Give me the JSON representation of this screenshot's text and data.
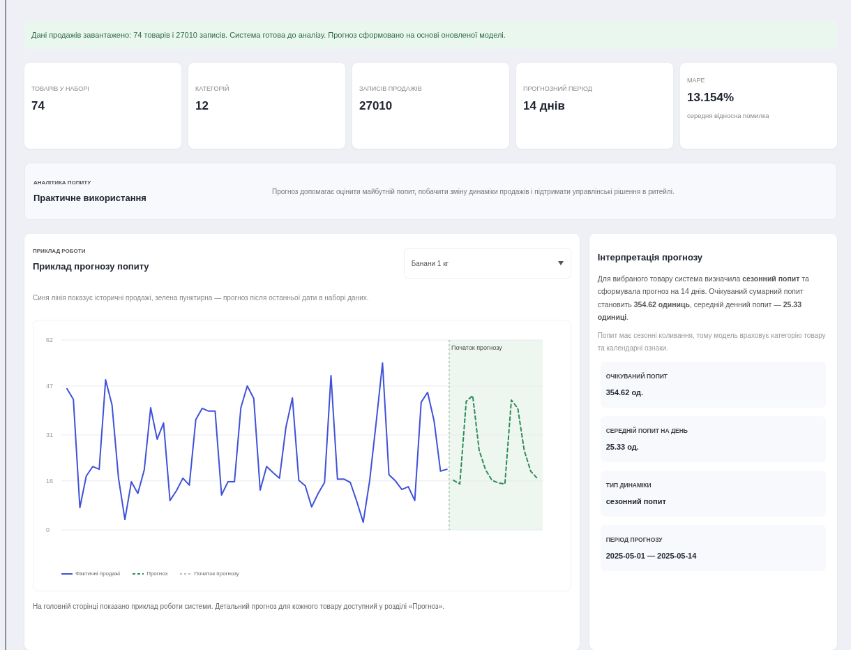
{
  "banner": "Дані продажів завантажено: 74 товарів і 27010 записів. Система готова до аналізу. Прогноз сформовано на основі оновленої моделі.",
  "stats": [
    {
      "label": "ТОВАРІВ У НАБОРІ",
      "value": "74"
    },
    {
      "label": "КАТЕГОРІЙ",
      "value": "12"
    },
    {
      "label": "ЗАПИСІВ ПРОДАЖІВ",
      "value": "27010"
    },
    {
      "label": "ПРОГНОЗНИЙ ПЕРІОД",
      "value": "14 днів"
    },
    {
      "label": "MAPE",
      "value": "13.154%",
      "note": "середня відносна помилка"
    }
  ],
  "usage": {
    "eyebrow": "АНАЛІТИКА ПОПИТУ",
    "title": "Практичне використання",
    "text": "Прогноз допомагає оцінити майбутній попит, побачити зміну динаміки продажів і підтримати управлінські рішення в ритейлі."
  },
  "example": {
    "eyebrow": "ПРИКЛАД РОБОТИ",
    "title": "Приклад прогнозу попиту",
    "product_select": "Банани 1 кг",
    "description": "Синя лінія показує історичні продажі, зелена пунктирна — прогноз після останньої дати в наборі даних.",
    "chart_data": {
      "type": "line",
      "grid": true,
      "ylim": [
        0,
        62
      ],
      "yticks": [
        0,
        16,
        31,
        47,
        62
      ],
      "annotations": [
        {
          "text": "Початок прогнозу"
        }
      ],
      "series": [
        {
          "name": "Фактичні продажі",
          "color": "#3f51d8",
          "line_style": "solid",
          "values": [
            46.1,
            42.6,
            7.3,
            17.6,
            20.7,
            19.8,
            49.0,
            40.8,
            16.9,
            3.4,
            15.7,
            11.9,
            19.6,
            39.9,
            29.6,
            34.9,
            9.6,
            12.8,
            16.9,
            14.6,
            36.0,
            39.7,
            38.8,
            38.8,
            11.4,
            15.7,
            15.7,
            39.9,
            47.0,
            42.9,
            13.0,
            20.7,
            18.7,
            16.9,
            33.5,
            43.1,
            16.2,
            14.4,
            7.5,
            11.9,
            15.5,
            50.4,
            16.6,
            16.6,
            15.5,
            9.3,
            2.5,
            16.0,
            34.9,
            54.5,
            18.0,
            16.0,
            13.2,
            14.1,
            9.6,
            41.7,
            44.9,
            35.6,
            19.2,
            19.8,
            null,
            null,
            null,
            null,
            null,
            null,
            null,
            null,
            null,
            null,
            null,
            null,
            null,
            null
          ]
        },
        {
          "name": "Прогноз",
          "color": "#2e8b57",
          "line_style": "dashed",
          "values": [
            null,
            null,
            null,
            null,
            null,
            null,
            null,
            null,
            null,
            null,
            null,
            null,
            null,
            null,
            null,
            null,
            null,
            null,
            null,
            null,
            null,
            null,
            null,
            null,
            null,
            null,
            null,
            null,
            null,
            null,
            null,
            null,
            null,
            null,
            null,
            null,
            null,
            null,
            null,
            null,
            null,
            null,
            null,
            null,
            null,
            null,
            null,
            null,
            null,
            null,
            null,
            null,
            null,
            null,
            null,
            null,
            null,
            null,
            null,
            null,
            16.2,
            15.0,
            42.0,
            43.8,
            26.0,
            19.6,
            16.2,
            15.3,
            15.0,
            42.4,
            39.7,
            26.0,
            19.2,
            16.9
          ]
        }
      ]
    },
    "start_legend": "Початок прогнозу",
    "footer": "На головній сторінці показано приклад роботи системи. Детальний прогноз для кожного товару доступний у розділі «Прогноз»."
  },
  "interpretation": {
    "title": "Інтерпретація прогнозу",
    "summary": "Для вибраного товару система визначила **сезонний попит** та сформувала прогноз на 14 днів. Очікуваний сумарний попит становить **354.62 одиниць**, середній денний попит — **25.33 одиниці**.",
    "note": "Попит має сезонні коливання, тому модель враховує категорію товару та календарні ознаки.",
    "facts": [
      {
        "label": "ОЧІКУВАНИЙ ПОПИТ",
        "value": "354.62 од."
      },
      {
        "label": "СЕРЕДНІЙ ПОПИТ НА ДЕНЬ",
        "value": "25.33 од."
      },
      {
        "label": "ТИП ДИНАМІКИ",
        "value": "сезонний попит"
      },
      {
        "label": "ПЕРІОД ПРОГНОЗУ",
        "value": "2025-05-01 — 2025-05-14"
      }
    ]
  }
}
